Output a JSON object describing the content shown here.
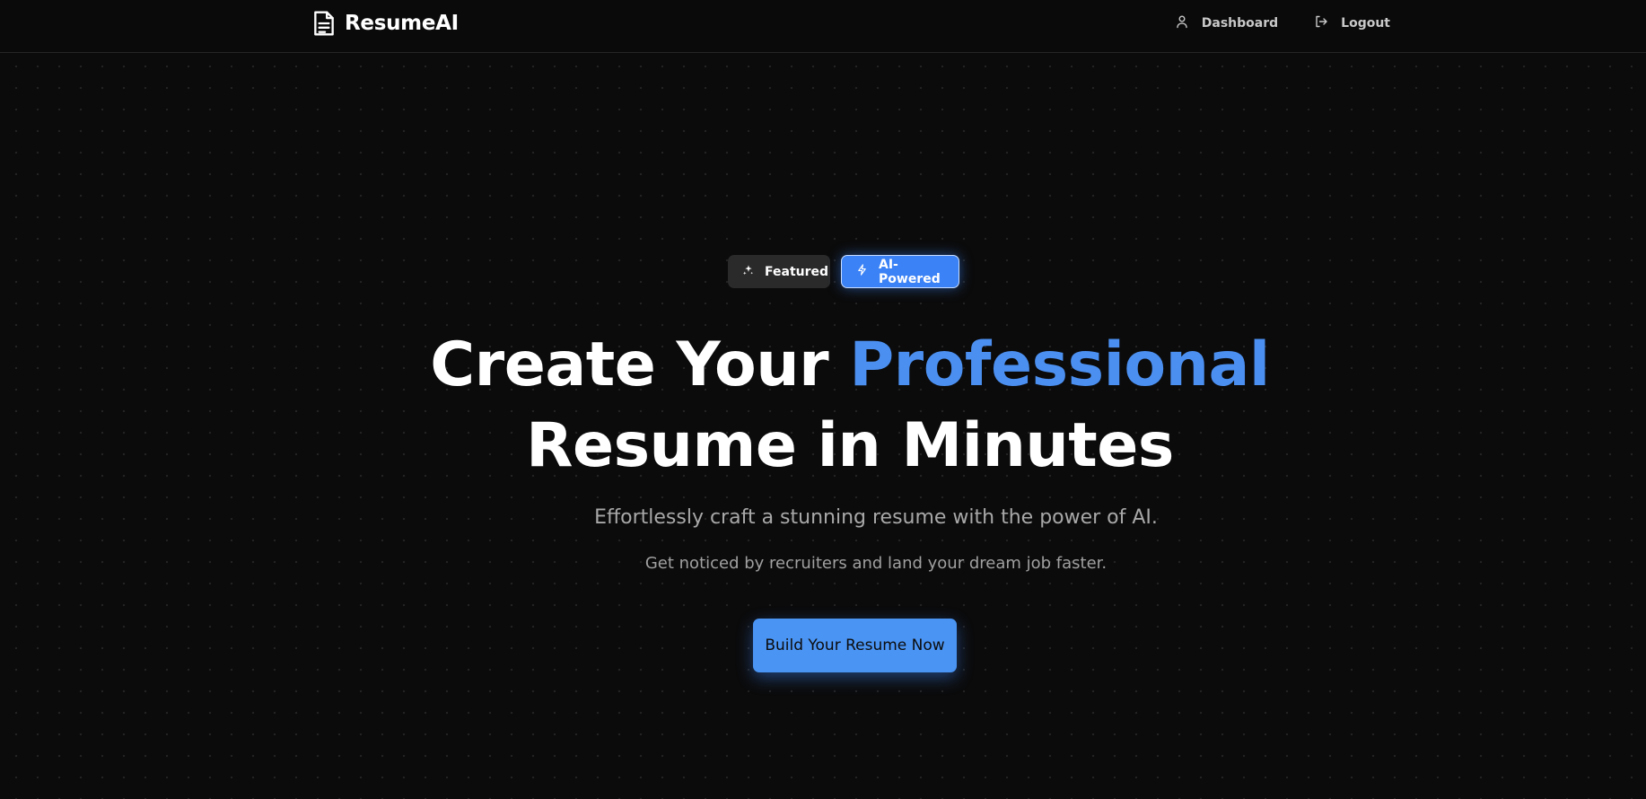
{
  "nav": {
    "brand": "ResumeAI",
    "brand_icon": "document-icon",
    "links": [
      {
        "label": "Dashboard",
        "icon": "user-icon"
      },
      {
        "label": "Logout",
        "icon": "logout-icon"
      }
    ]
  },
  "hero": {
    "badges": [
      {
        "label": "Featured",
        "icon": "sparkles-icon"
      },
      {
        "label": "AI-Powered",
        "icon": "zap-icon"
      }
    ],
    "title_part1": "Create Your ",
    "title_accent": "Professional",
    "title_part2": "Resume in Minutes",
    "subtitle": "Effortlessly craft a stunning resume with the power of AI.",
    "tagline": "Get noticed by recruiters and land your dream job faster.",
    "cta_label": "Build Your Resume Now"
  },
  "colors": {
    "background": "#0b0b0b",
    "accent": "#4b8ff0",
    "button": "#4a94f3",
    "badge_ai": "#3b82f6",
    "badge_featured": "#2a2a2a"
  }
}
